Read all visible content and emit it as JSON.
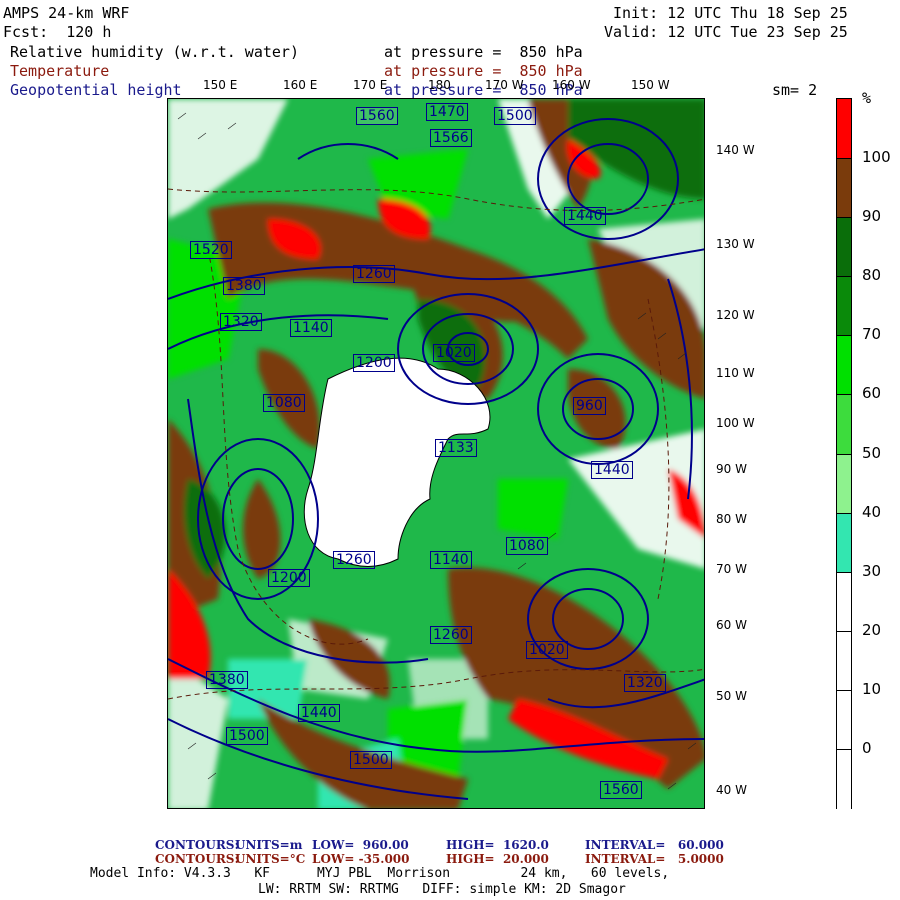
{
  "header": {
    "model_name": "AMPS 24-km WRF",
    "forecast": "Fcst:  120 h",
    "init": "Init: 12 UTC Thu 18 Sep 25",
    "valid": "Valid: 12 UTC Tue 23 Sep 25",
    "field1_name": "Relative humidity (w.r.t. water)",
    "field1_level": "at pressure =  850 hPa",
    "field2_name": "Temperature",
    "field2_level": "at pressure =  850 hPa",
    "field3_name": "Geopotential height",
    "field3_level": "at pressure =  850 hPa",
    "smoothing": "sm= 2"
  },
  "longitude_labels_top": [
    "150 E",
    "160 E",
    "170 E",
    "180",
    "170 W",
    "160 W",
    "150 W"
  ],
  "latitude_labels_right": [
    "140 W",
    "130 W",
    "120 W",
    "110 W",
    "100 W",
    "90 W",
    "80 W",
    "70 W",
    "60 W",
    "50 W",
    "40 W"
  ],
  "colorbar": {
    "unit": "%",
    "labels": [
      "100",
      "90",
      "80",
      "70",
      "60",
      "50",
      "40",
      "30",
      "20",
      "10",
      "0"
    ],
    "colors": [
      "#ff0000",
      "#7a3b0c",
      "#0a6e0a",
      "#0a8a0a",
      "#00e000",
      "#3ddc3d",
      "#8ef28e",
      "#33e6b0",
      "#ffffff",
      "#ffffff",
      "#ffffff",
      "#ffffff"
    ]
  },
  "contour_labels": [
    "1560",
    "1470",
    "1566",
    "1500",
    "1440",
    "1520",
    "1380",
    "1320",
    "1260",
    "1200",
    "1140",
    "1080",
    "1020",
    "960",
    "1133",
    "1440",
    "1260",
    "1200",
    "1140",
    "1080",
    "1020",
    "1260",
    "1320",
    "1380",
    "1440",
    "1500",
    "1500",
    "1560"
  ],
  "footer": {
    "contours1_label": "CONTOURS:",
    "contours1_units": "UNITS=m",
    "contours1_low": "LOW=  960.00",
    "contours1_high": "HIGH=  1620.0",
    "contours1_interval": "INTERVAL=   60.000",
    "contours2_label": "CONTOURS:",
    "contours2_units": "UNITS=°C",
    "contours2_low": "LOW= -35.000",
    "contours2_high": "HIGH=  20.000",
    "contours2_interval": "INTERVAL=   5.0000",
    "model_info_line": "Model Info: V4.3.3   KF      MYJ PBL  Morrison         24 km,   60 levels,",
    "model_info_line2": "LW: RRTM SW: RRTMG   DIFF: simple KM: 2D Smagor"
  }
}
